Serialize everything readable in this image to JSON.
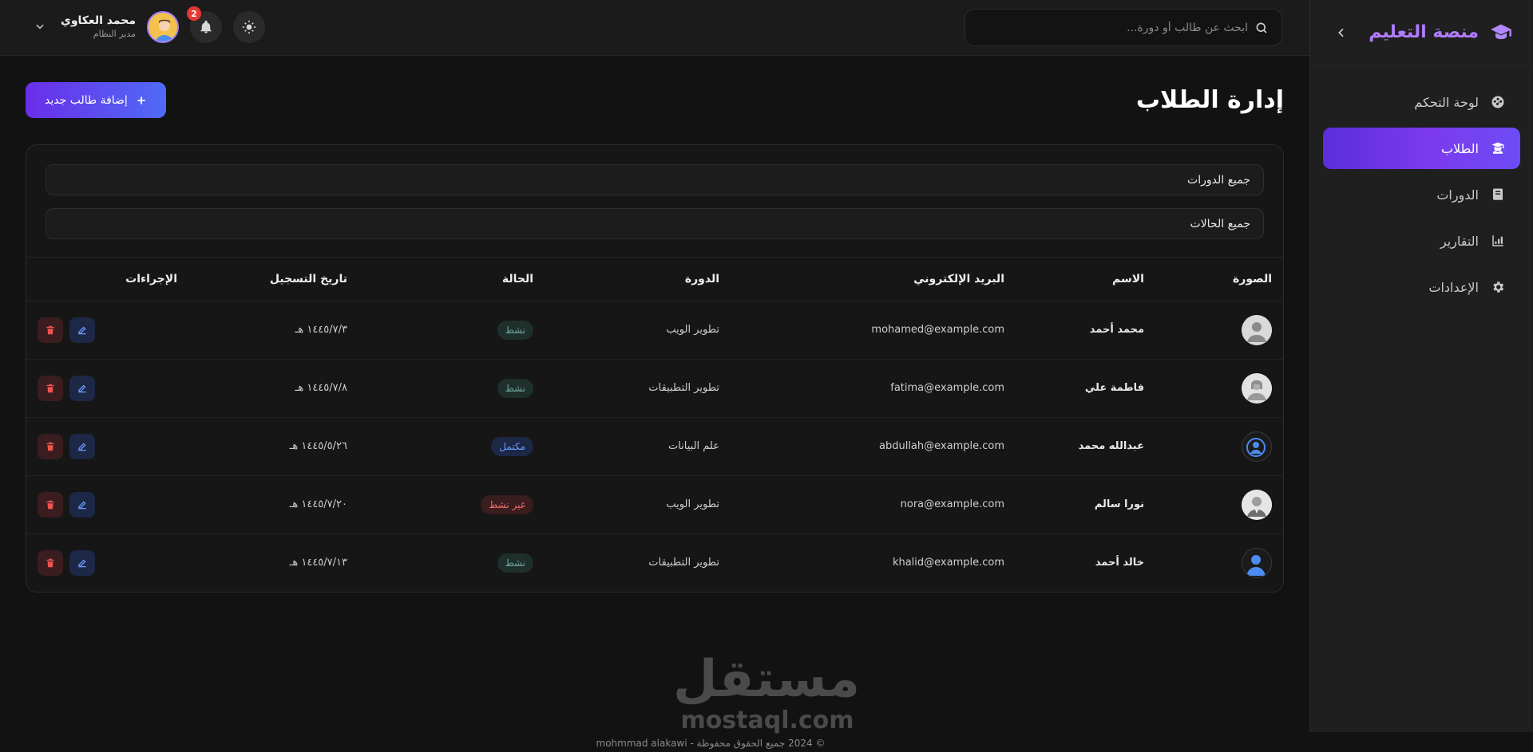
{
  "brand": {
    "title": "منصة التعليم"
  },
  "sidebar": {
    "items": [
      {
        "label": "لوحة التحكم",
        "icon": "dashboard-icon"
      },
      {
        "label": "الطلاب",
        "icon": "students-icon",
        "active": true
      },
      {
        "label": "الدورات",
        "icon": "book-icon"
      },
      {
        "label": "التقارير",
        "icon": "chart-icon"
      },
      {
        "label": "الإعدادات",
        "icon": "gear-icon"
      }
    ]
  },
  "topbar": {
    "search_placeholder": "ابحث عن طالب أو دورة...",
    "user_name": "محمد العكاوي",
    "user_role": "مدير النظام",
    "notifications": "2"
  },
  "page": {
    "title": "إدارة الطلاب",
    "add_label": "إضافة طالب جديد"
  },
  "filters": {
    "course": "جميع الدورات",
    "status": "جميع الحالات"
  },
  "table": {
    "headers": {
      "photo": "الصورة",
      "name": "الاسم",
      "email": "البريد الإلكتروني",
      "course": "الدورة",
      "status": "الحالة",
      "date": "تاريخ التسجيل",
      "actions": "الإجراءات"
    },
    "rows": [
      {
        "name": "محمد أحمد",
        "email": "mohamed@example.com",
        "course": "تطوير الويب",
        "status": "نشط",
        "status_type": "active",
        "date": "١٤٤٥/٧/٣ هـ"
      },
      {
        "name": "فاطمة علي",
        "email": "fatima@example.com",
        "course": "تطوير التطبيقات",
        "status": "نشط",
        "status_type": "active",
        "date": "١٤٤٥/٧/٨ هـ"
      },
      {
        "name": "عبدالله محمد",
        "email": "abdullah@example.com",
        "course": "علم البيانات",
        "status": "مكتمل",
        "status_type": "done",
        "date": "١٤٤٥/٥/٢٦ هـ"
      },
      {
        "name": "نورا سالم",
        "email": "nora@example.com",
        "course": "تطوير الويب",
        "status": "غير نشط",
        "status_type": "inactive",
        "date": "١٤٤٥/٧/٢٠ هـ"
      },
      {
        "name": "خالد أحمد",
        "email": "khalid@example.com",
        "course": "تطوير التطبيقات",
        "status": "نشط",
        "status_type": "active",
        "date": "١٤٤٥/٧/١٣ هـ"
      }
    ]
  },
  "watermark": {
    "ar": "مستقل",
    "en": "mostaql.com"
  },
  "footer": {
    "text": "© 2024 جميع الحقوق محفوظة - mohmmad alakawi"
  },
  "colors": {
    "accent": "#7c3aed",
    "brand": "#b07cff",
    "danger": "#e53935"
  }
}
